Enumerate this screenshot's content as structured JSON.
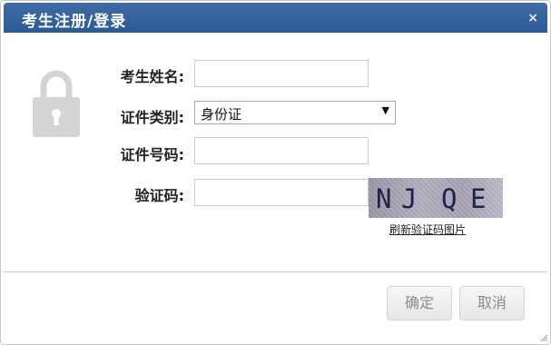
{
  "dialog": {
    "title": "考生注册/登录",
    "close_symbol": "×",
    "title_bar_color": "#3a66a0"
  },
  "form": {
    "name_label": "考生姓名:",
    "name_value": "",
    "id_type_label": "证件类别:",
    "id_type_selected": "身份证",
    "id_number_label": "证件号码:",
    "id_number_value": "",
    "captcha_label": "验证码:",
    "captcha_value": "",
    "captcha_chars": [
      "N",
      "J",
      "Q",
      "E"
    ],
    "refresh_label": "刷新验证码图片"
  },
  "buttons": {
    "confirm_label": "确定",
    "cancel_label": "取消"
  },
  "icons": {
    "lock": "lock-icon",
    "close": "close-icon",
    "select_arrow": "chevron-down-icon",
    "resize": "resize-grip-icon"
  }
}
